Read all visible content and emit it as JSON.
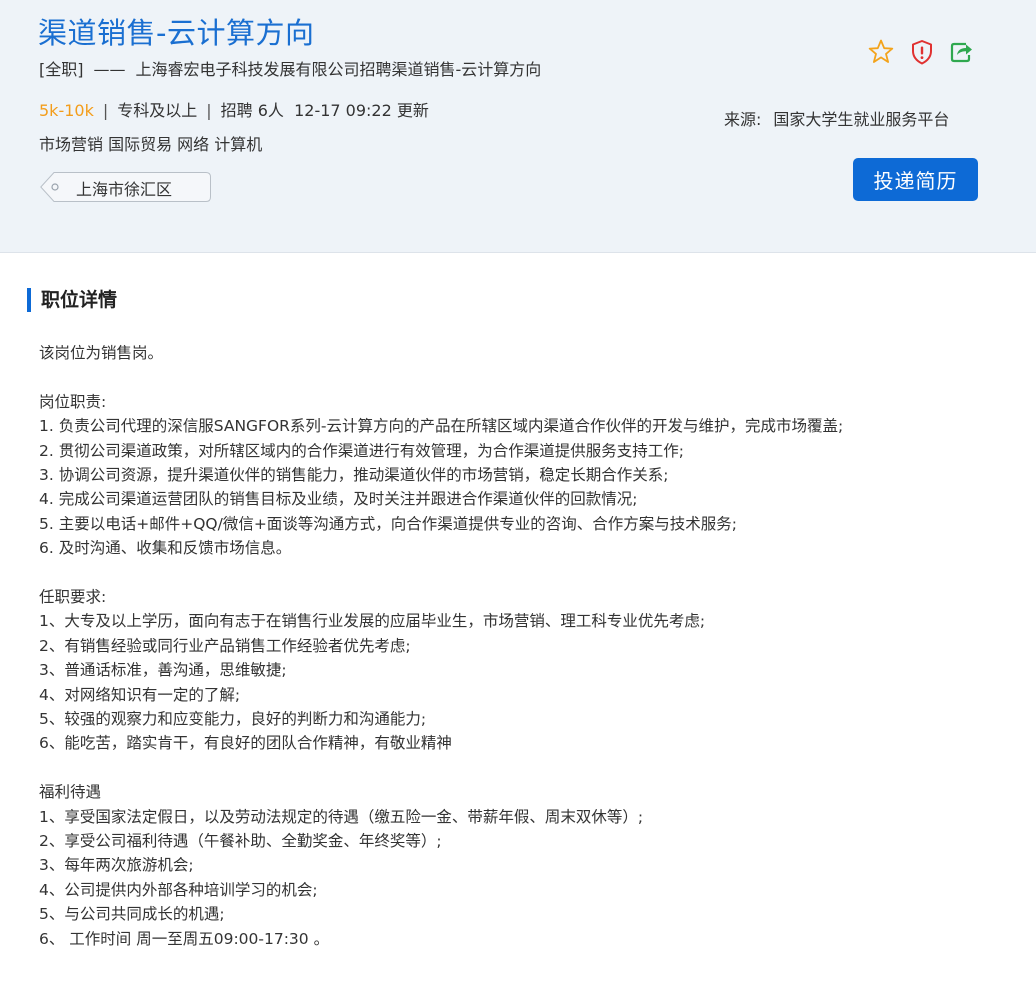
{
  "job": {
    "title": "渠道销售-云计算方向",
    "type": "[全职]",
    "dash": "——",
    "company_line": "上海睿宏电子科技发展有限公司招聘渠道销售-云计算方向",
    "salary": "5k-10k",
    "separator": "|",
    "education": "专科及以上",
    "headcount": "招聘 6人",
    "updated": "12-17 09:22 更新",
    "tags": "市场营销 国际贸易 网络 计算机",
    "location": "上海市徐汇区"
  },
  "source": {
    "label": "来源:",
    "name": "国家大学生就业服务平台"
  },
  "actions": {
    "apply_label": "投递简历",
    "icons": [
      "star-icon",
      "report-shield-icon",
      "share-icon"
    ]
  },
  "colors": {
    "accent": "#0d6ad6",
    "title": "#1a6fd1",
    "salary": "#f39d1b",
    "star": "#f3a31b",
    "report": "#e03131",
    "share": "#2fa84f"
  },
  "detail": {
    "section_title": "职位详情",
    "intro": "该岗位为销售岗。",
    "duties_title": "岗位职责:",
    "duties": [
      "1. 负责公司代理的深信服SANGFOR系列-云计算方向的产品在所辖区域内渠道合作伙伴的开发与维护，完成市场覆盖;",
      "2. 贯彻公司渠道政策，对所辖区域内的合作渠道进行有效管理，为合作渠道提供服务支持工作;",
      "3. 协调公司资源，提升渠道伙伴的销售能力，推动渠道伙伴的市场营销，稳定长期合作关系;",
      "4. 完成公司渠道运营团队的销售目标及业绩，及时关注并跟进合作渠道伙伴的回款情况;",
      "5. 主要以电话+邮件+QQ/微信+面谈等沟通方式，向合作渠道提供专业的咨询、合作方案与技术服务;",
      "6. 及时沟通、收集和反馈市场信息。"
    ],
    "requirements_title": "任职要求:",
    "requirements": [
      "1、大专及以上学历，面向有志于在销售行业发展的应届毕业生，市场营销、理工科专业优先考虑;",
      "2、有销售经验或同行业产品销售工作经验者优先考虑;",
      "3、普通话标准，善沟通，思维敏捷;",
      "4、对网络知识有一定的了解;",
      "5、较强的观察力和应变能力，良好的判断力和沟通能力;",
      "6、能吃苦，踏实肯干，有良好的团队合作精神，有敬业精神"
    ],
    "benefits_title": "福利待遇",
    "benefits": [
      "1、享受国家法定假日，以及劳动法规定的待遇（缴五险一金、带薪年假、周末双休等）;",
      "2、享受公司福利待遇（午餐补助、全勤奖金、年终奖等）;",
      "3、每年两次旅游机会;",
      "4、公司提供内外部各种培训学习的机会;",
      "5、与公司共同成长的机遇;",
      "6、 工作时间 周一至周五09:00-17:30 。"
    ]
  }
}
